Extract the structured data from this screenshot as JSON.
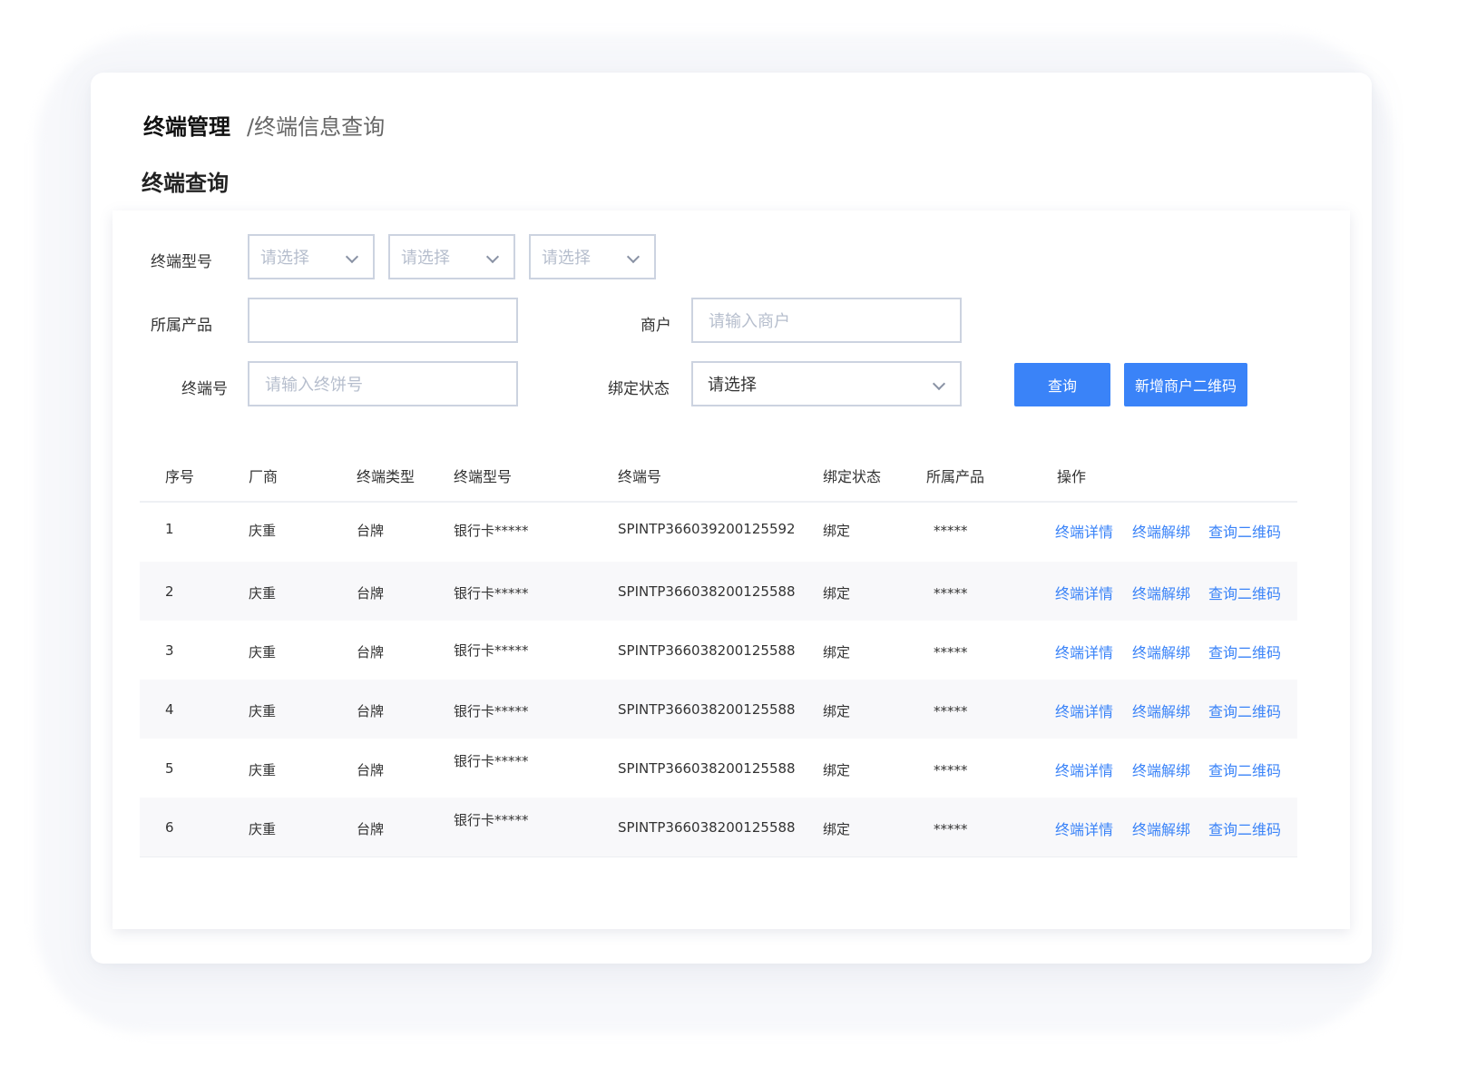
{
  "breadcrumb": {
    "root": "终端管理",
    "current": "/终端信息查询"
  },
  "page_title": "终端查询",
  "form": {
    "terminal_model_label": "终端型号",
    "terminal_model_selects": [
      "请选择",
      "请选择",
      "请选择"
    ],
    "product_label": "所属产品",
    "product_value": "",
    "merchant_label": "商户",
    "merchant_placeholder": "请输入商户",
    "terminal_no_label": "终端号",
    "terminal_no_placeholder": "请输入终饼号",
    "bind_status_label": "绑定状态",
    "bind_status_value": "请选择",
    "query_button": "查询",
    "add_qr_button": "新增商户二维码"
  },
  "table": {
    "headers": [
      "序号",
      "厂商",
      "终端类型",
      "终端型号",
      "终端号",
      "绑定状态",
      "所属产品",
      "操作"
    ],
    "actions": [
      "终端详情",
      "终端解绑",
      "查询二维码"
    ],
    "rows": [
      {
        "no": "1",
        "vendor": "庆重",
        "type": "台牌",
        "model": "银行卡*****",
        "terminal_no": "SPINTP366039200125592",
        "status": "绑定",
        "product": "*****"
      },
      {
        "no": "2",
        "vendor": "庆重",
        "type": "台牌",
        "model": "银行卡*****",
        "terminal_no": "SPINTP366038200125588",
        "status": "绑定",
        "product": "*****"
      },
      {
        "no": "3",
        "vendor": "庆重",
        "type": "台牌",
        "model": "银行卡*****",
        "terminal_no": "SPINTP366038200125588",
        "status": "绑定",
        "product": "*****"
      },
      {
        "no": "4",
        "vendor": "庆重",
        "type": "台牌",
        "model": "银行卡*****",
        "terminal_no": "SPINTP366038200125588",
        "status": "绑定",
        "product": "*****"
      },
      {
        "no": "5",
        "vendor": "庆重",
        "type": "台牌",
        "model": "银行卡*****",
        "terminal_no": "SPINTP366038200125588",
        "status": "绑定",
        "product": "*****"
      },
      {
        "no": "6",
        "vendor": "庆重",
        "type": "台牌",
        "model": "银行卡*****",
        "terminal_no": "SPINTP366038200125588",
        "status": "绑定",
        "product": "*****"
      }
    ]
  },
  "colors": {
    "primary": "#3a83f8",
    "row_alt": "#f8f8fa",
    "border": "#ccd3e0"
  },
  "icons": {
    "select_arrow": "chevron-down-icon"
  }
}
